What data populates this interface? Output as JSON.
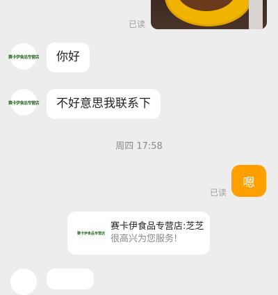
{
  "read_receipt": "已读",
  "shop_short_name": "赛卡伊食品专营店",
  "messages": {
    "hello": "你好",
    "sorry": "不好意思我联系下",
    "reply": "嗯"
  },
  "timestamp": "周四 17:58",
  "card": {
    "title": "赛卡伊食品专营店:芝芝",
    "subtitle": "很高兴为您服务!"
  },
  "colors": {
    "outgoing": "#ff9f00",
    "background": "#ededed"
  }
}
